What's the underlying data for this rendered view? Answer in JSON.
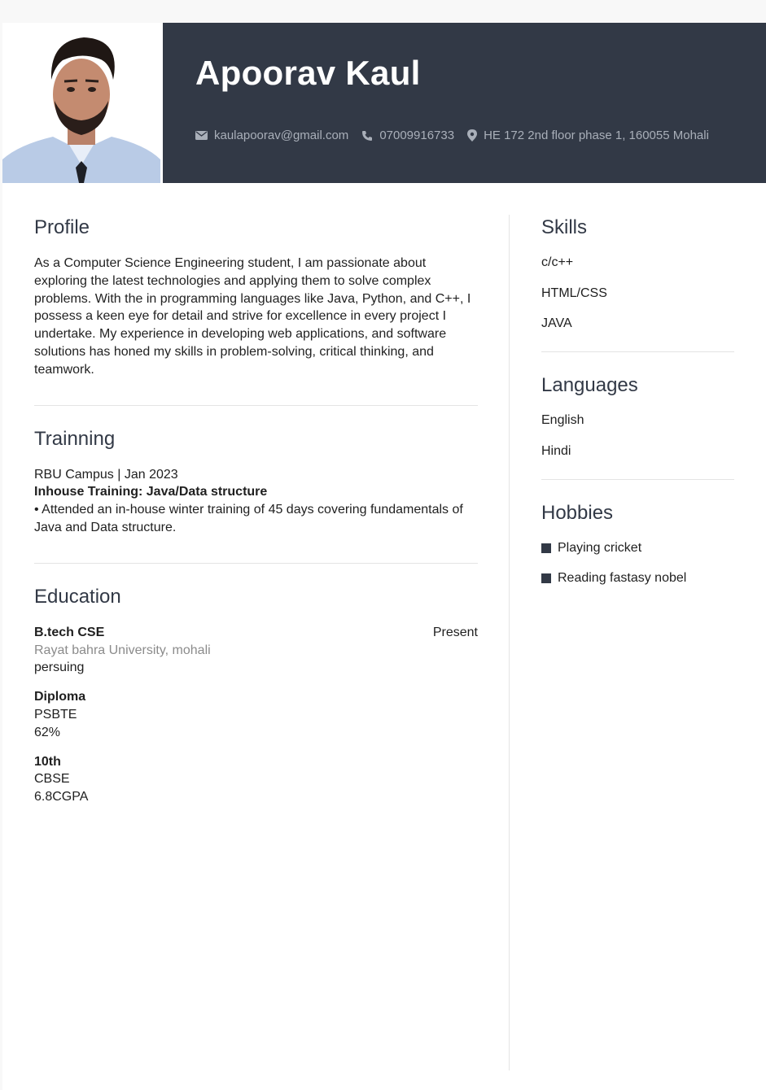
{
  "header": {
    "name": "Apoorav Kaul",
    "email": "kaulapoorav@gmail.com",
    "phone": "07009916733",
    "address": "HE 172  2nd floor phase 1, 160055 Mohali"
  },
  "profile": {
    "title": "Profile",
    "text": "As a Computer Science Engineering student, I am passionate about exploring the latest technologies and applying them to solve complex problems. With the in programming languages like Java, Python, and C++, I possess a keen eye for detail and strive for excellence in every project I undertake. My experience in developing web applications, and software solutions has honed my skills in problem-solving, critical thinking, and teamwork."
  },
  "training": {
    "title": "Trainning",
    "org_date": "RBU Campus |  Jan 2023",
    "role": "Inhouse Training: Java/Data structure",
    "bullet": "• Attended an in-house winter training of 45 days covering fundamentals of Java and Data structure."
  },
  "education": {
    "title": "Education",
    "items": [
      {
        "degree": "B.tech CSE",
        "date": "Present",
        "institute": "Rayat bahra University, mohali",
        "detail": "persuing"
      },
      {
        "degree": "Diploma",
        "date": "",
        "institute": "PSBTE",
        "detail": "62%"
      },
      {
        "degree": "10th",
        "date": "",
        "institute": "CBSE",
        "detail": "6.8CGPA"
      }
    ]
  },
  "skills": {
    "title": "Skills",
    "items": [
      "c/c++",
      "HTML/CSS",
      "JAVA"
    ]
  },
  "languages": {
    "title": "Languages",
    "items": [
      "English",
      "Hindi"
    ]
  },
  "hobbies": {
    "title": "Hobbies",
    "items": [
      "Playing cricket",
      "Reading fastasy nobel"
    ]
  },
  "colors": {
    "banner": "#323946",
    "contact_text": "#a9afb9",
    "accent_square": "#323946"
  }
}
